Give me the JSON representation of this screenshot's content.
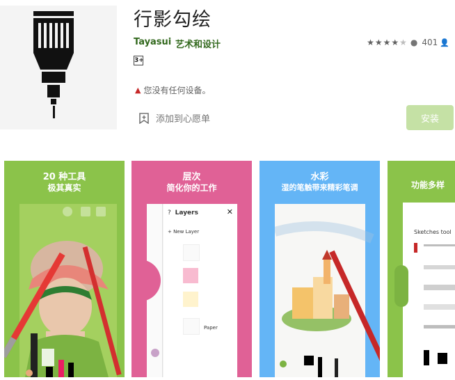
{
  "app": {
    "title": "行影勾绘",
    "developer": "Tayasui",
    "category": "艺术和设计",
    "rating_stars": 4,
    "rating_count": "401",
    "age_rating": "3+",
    "device_warning": "您没有任何设备。",
    "wishlist_label": "添加到心愿单",
    "install_label": "安装",
    "icon": "technical-pen-icon"
  },
  "screenshots": [
    {
      "line1": "20 种工具",
      "line2": "极其真实",
      "bg": "#8bc34a"
    },
    {
      "line1": "层次",
      "line2": "简化你的工作",
      "bg": "#e06196"
    },
    {
      "line1": "水彩",
      "line2": "湿的笔触带来精彩笔调",
      "bg": "#64b5f6"
    },
    {
      "line1": "功能多样",
      "line2": "",
      "bg": "#8bc34a"
    }
  ],
  "layers_panel": {
    "title": "Layers",
    "help": "?",
    "new_layer": "+ New Layer",
    "paper": "Paper"
  },
  "tools_panel": {
    "title": "Sketches tool"
  },
  "colors": {
    "accent_green": "#33691e",
    "install_bg": "#c5e1a5",
    "warning": "#c62828"
  }
}
